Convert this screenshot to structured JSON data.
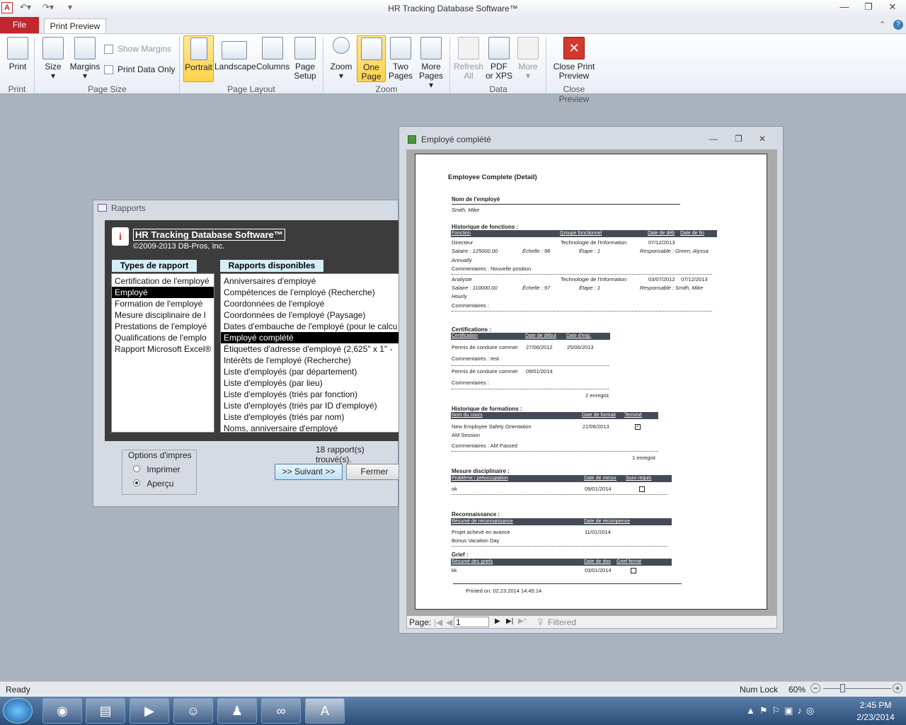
{
  "app": {
    "title": "HR Tracking Database Software™",
    "icon_letter": "A"
  },
  "tabs": {
    "file": "File",
    "print_preview": "Print Preview"
  },
  "ribbon": {
    "print": "Print",
    "size": "Size",
    "margins": "Margins",
    "show_margins": "Show Margins",
    "print_data_only": "Print Data Only",
    "portrait": "Portrait",
    "landscape": "Landscape",
    "columns": "Columns",
    "page_setup_1": "Page",
    "page_setup_2": "Setup",
    "zoom": "Zoom",
    "one_page_1": "One",
    "one_page_2": "Page",
    "two_pages_1": "Two",
    "two_pages_2": "Pages",
    "more_pages_1": "More",
    "more_pages_2": "Pages",
    "refresh_1": "Refresh",
    "refresh_2": "All",
    "pdf_1": "PDF",
    "pdf_2": "or XPS",
    "more": "More",
    "close_1": "Close Print",
    "close_2": "Preview",
    "groups": {
      "print": "Print",
      "page_size": "Page Size",
      "page_layout": "Page Layout",
      "zoom": "Zoom",
      "data": "Data",
      "close_preview": "Close Preview"
    }
  },
  "rapports": {
    "window_title": "Rapports",
    "app_title": "HR Tracking Database Software™",
    "copyright": "©2009-2013 DB-Pros, Inc.",
    "types_header": "Types de rapport",
    "available_header": "Rapports disponibles",
    "types": [
      "Certification de l'employé",
      "Employé",
      "Formation de l'employé",
      "Mesure disciplinaire de l",
      "Prestations de l'employé",
      "Qualifications de l'emplo",
      "Rapport Microsoft Excel®"
    ],
    "reports": [
      "Anniversaires d'employé",
      "Compétences de l'employé (Recherche)",
      "Coordonnées de l'employé",
      "Coordonnées de l'employé (Paysage)",
      "Dates d'embauche de l'employé (pour le calcu",
      "Employé complété",
      "Étiquettes d'adresse d'employé (2,625\" x 1\" - ",
      "Intérêts de l'employé (Recherche)",
      "Liste d'employés (par département)",
      "Liste d'employés (par lieu)",
      "Liste d'employés (triés par fonction)",
      "Liste d'employés (triés par ID d'employé)",
      "Liste d'employés (triés par nom)",
      "Noms, anniversaire d'employé"
    ],
    "count": "18 rapport(s) trouvé(s).",
    "options_label": "Options d'impres",
    "opt_print": "Imprimer",
    "opt_preview": "Aperçu",
    "next": ">> Suivant >>",
    "close": "Fermer"
  },
  "preview": {
    "window_title": "Employé complété",
    "report": {
      "title": "Employee Complete (Detail)",
      "name_label": "Nom de l'employé",
      "name": "Smith, Mike",
      "jobs_h": "Historique de fonctions :",
      "jobs_cols": [
        "Fonction",
        "Groupe fonctionnel",
        "Date de déb",
        "Date de fin"
      ],
      "job1": {
        "title": "Directeur",
        "group": "Technologie de l'Information",
        "start": "07/12/2013",
        "salary": "Salaire :     125000.00",
        "echelle": "Échelle : 98",
        "etape": "Étape : 1",
        "resp": "Responsable : Green, Alyssa",
        "freq": "Annually",
        "comm": "Commentaires :  Nouvelle position"
      },
      "job2": {
        "title": "Analyste",
        "group": "Technologie de l'Information",
        "start": "03/07/2012",
        "end": "07/12/2013",
        "salary": "Salaire :     110000.00",
        "echelle": "Échelle : 97",
        "etape": "Étape : 1",
        "resp": "Responsable : Smith, Mike",
        "freq": "Hourly",
        "comm": "Commentaires :"
      },
      "cert_h": "Certifications :",
      "cert_cols": [
        "Certification",
        "Date de début",
        "Date d'exp."
      ],
      "cert1": {
        "name": "Permis de conduire commer",
        "start": "27/06/2012",
        "exp": "25/06/2013",
        "comm": "Commentaires :  test"
      },
      "cert2": {
        "name": "Permis de conduire commer",
        "start": "09/01/2014",
        "comm": "Commentaires :"
      },
      "cert_count": "2 enregist",
      "train_h": "Historique de formations :",
      "train_cols": [
        "Nom du cours",
        "Date de formati",
        "Terminé"
      ],
      "train1": {
        "name": "New Employee Safety Orientation",
        "session": "AM Session",
        "date": "21/06/2013",
        "comm": "Commentaires :  AM Passed"
      },
      "train_count": "1 enregist",
      "disc_h": "Mesure disciplinaire :",
      "disc_cols": [
        "Problème / préoccupation",
        "Date de mesur",
        "Suivi requis"
      ],
      "disc1": {
        "name": "ok",
        "date": "09/01/2014"
      },
      "rec_h": "Reconnaissance :",
      "rec_cols": [
        "Résumé de reconnaissance",
        "Date de récompense"
      ],
      "rec1": {
        "name": "Projet achevé en avance",
        "date": "11/01/2014",
        "detail": "Bonus Vacation Day"
      },
      "grief_h": "Grief :",
      "grief_cols": [
        "Résumé des griefs",
        "Date de dos",
        "Grief fermé"
      ],
      "grief1": {
        "name": "kk",
        "date": "03/01/2014"
      },
      "printed": "Printed on:  02.23.2014 14:45:14"
    },
    "nav": {
      "page_label": "Page:",
      "page": "1",
      "filter": "Filtered"
    }
  },
  "status": {
    "ready": "Ready",
    "numlock": "Num Lock",
    "zoom": "60%"
  },
  "taskbar": {
    "time": "2:45 PM",
    "date": "2/23/2014"
  },
  "zoom_level": 0.6
}
